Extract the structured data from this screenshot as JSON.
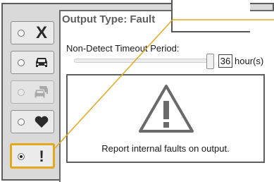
{
  "panel": {
    "title": "Output Type: Fault",
    "timeout_label": "Non-Detect Timeout Period:",
    "timeout_value": "36",
    "timeout_unit": "hour(s)",
    "description": "Report internal faults on output."
  },
  "output_types": [
    {
      "name": "none",
      "icon": "x-icon",
      "glyph": "X",
      "selected": false,
      "enabled": true
    },
    {
      "name": "vehicle",
      "icon": "car-icon",
      "selected": false,
      "enabled": true
    },
    {
      "name": "multiple-vehicles",
      "icon": "cars-icon",
      "selected": false,
      "enabled": false
    },
    {
      "name": "health",
      "icon": "heart-icon",
      "selected": false,
      "enabled": true
    },
    {
      "name": "fault",
      "icon": "exclamation-icon",
      "glyph": "!",
      "selected": true,
      "enabled": true
    }
  ],
  "colors": {
    "highlight": "#e4a81b",
    "frame": "#5c5c5c",
    "toolbar_background": "#d9d9d9"
  }
}
